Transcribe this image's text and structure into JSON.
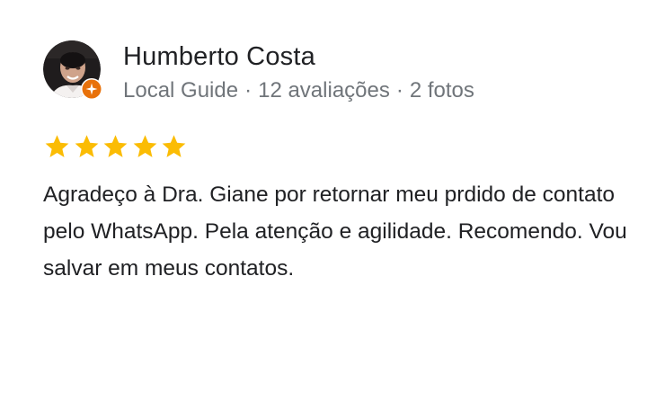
{
  "review": {
    "reviewer_name": "Humberto Costa",
    "badge_icon": "local-guide-badge-icon",
    "meta": {
      "guide_label": "Local Guide",
      "reviews_count": "12 avaliações",
      "photos_count": "2 fotos",
      "separator": "·"
    },
    "rating": 5,
    "rating_max": 5,
    "star_icon": "star-icon",
    "text": "Agradeço à Dra. Giane por retornar meu prdido de contato pelo WhatsApp. Pela atenção e agilidade. Recomendo. Vou salvar em meus contatos."
  },
  "colors": {
    "star": "#fbbc04",
    "badge": "#e8710a",
    "primary_text": "#202124",
    "secondary_text": "#70757a"
  }
}
